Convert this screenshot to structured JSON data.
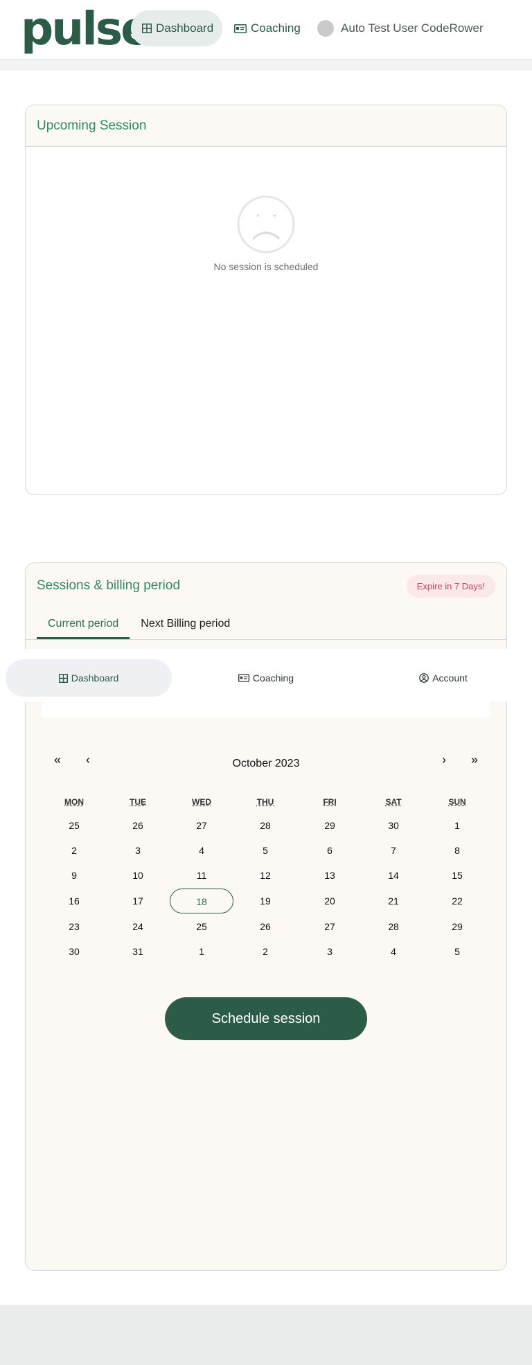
{
  "header": {
    "logo": "pulse",
    "nav": [
      {
        "label": "Dashboard",
        "icon": "grid-icon",
        "active": true
      },
      {
        "label": "Coaching",
        "icon": "id-card-icon",
        "active": false
      }
    ],
    "user_name": "Auto Test User CodeRower"
  },
  "upcoming": {
    "title": "Upcoming Session",
    "empty_icon": "sad-face-icon",
    "empty_text": "No session is scheduled"
  },
  "billing": {
    "title": "Sessions & billing period",
    "badge": "Expire in 7 Days!",
    "tabs": [
      {
        "label": "Current period",
        "active": true
      },
      {
        "label": "Next Billing period",
        "active": false
      }
    ]
  },
  "bottom_nav": [
    {
      "label": "Dashboard",
      "icon": "grid-icon",
      "active": true
    },
    {
      "label": "Coaching",
      "icon": "id-card-icon",
      "active": false
    },
    {
      "label": "Account",
      "icon": "user-circle-icon",
      "active": false
    }
  ],
  "calendar": {
    "month_label": "October 2023",
    "nav": {
      "prev_year": "«",
      "prev_month": "‹",
      "next_month": "›",
      "next_year": "»"
    },
    "weekdays": [
      "MON",
      "TUE",
      "WED",
      "THU",
      "FRI",
      "SAT",
      "SUN"
    ],
    "weeks": [
      [
        "25",
        "26",
        "27",
        "28",
        "29",
        "30",
        "1"
      ],
      [
        "2",
        "3",
        "4",
        "5",
        "6",
        "7",
        "8"
      ],
      [
        "9",
        "10",
        "11",
        "12",
        "13",
        "14",
        "15"
      ],
      [
        "16",
        "17",
        "18",
        "19",
        "20",
        "21",
        "22"
      ],
      [
        "23",
        "24",
        "25",
        "26",
        "27",
        "28",
        "29"
      ],
      [
        "30",
        "31",
        "1",
        "2",
        "3",
        "4",
        "5"
      ]
    ],
    "selected_day": "18"
  },
  "schedule_button": "Schedule session",
  "colors": {
    "brand": "#2a5c48",
    "accent_text": "#2e8a60",
    "badge_text": "#c7445b",
    "badge_bg": "#fbe9ea"
  }
}
